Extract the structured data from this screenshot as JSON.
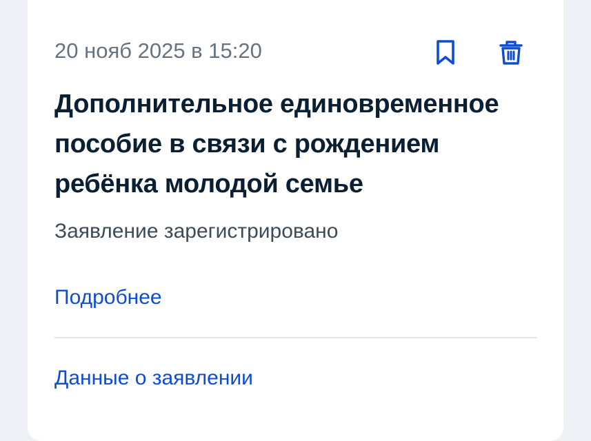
{
  "card": {
    "date": "20 нояб 2025 в 15:20",
    "title": "Дополнительное единовременное пособие в связи с рождением ребёнка молодой семье",
    "status": "Заявление зарегистрировано",
    "details_link": "Подробнее",
    "application_link": "Данные о заявлении",
    "icons": {
      "bookmark": "bookmark-icon",
      "delete": "trash-icon"
    }
  },
  "colors": {
    "accent": "#0d4cd3",
    "title": "#0b1f33",
    "muted": "#66727f",
    "background": "#eef1f5"
  }
}
